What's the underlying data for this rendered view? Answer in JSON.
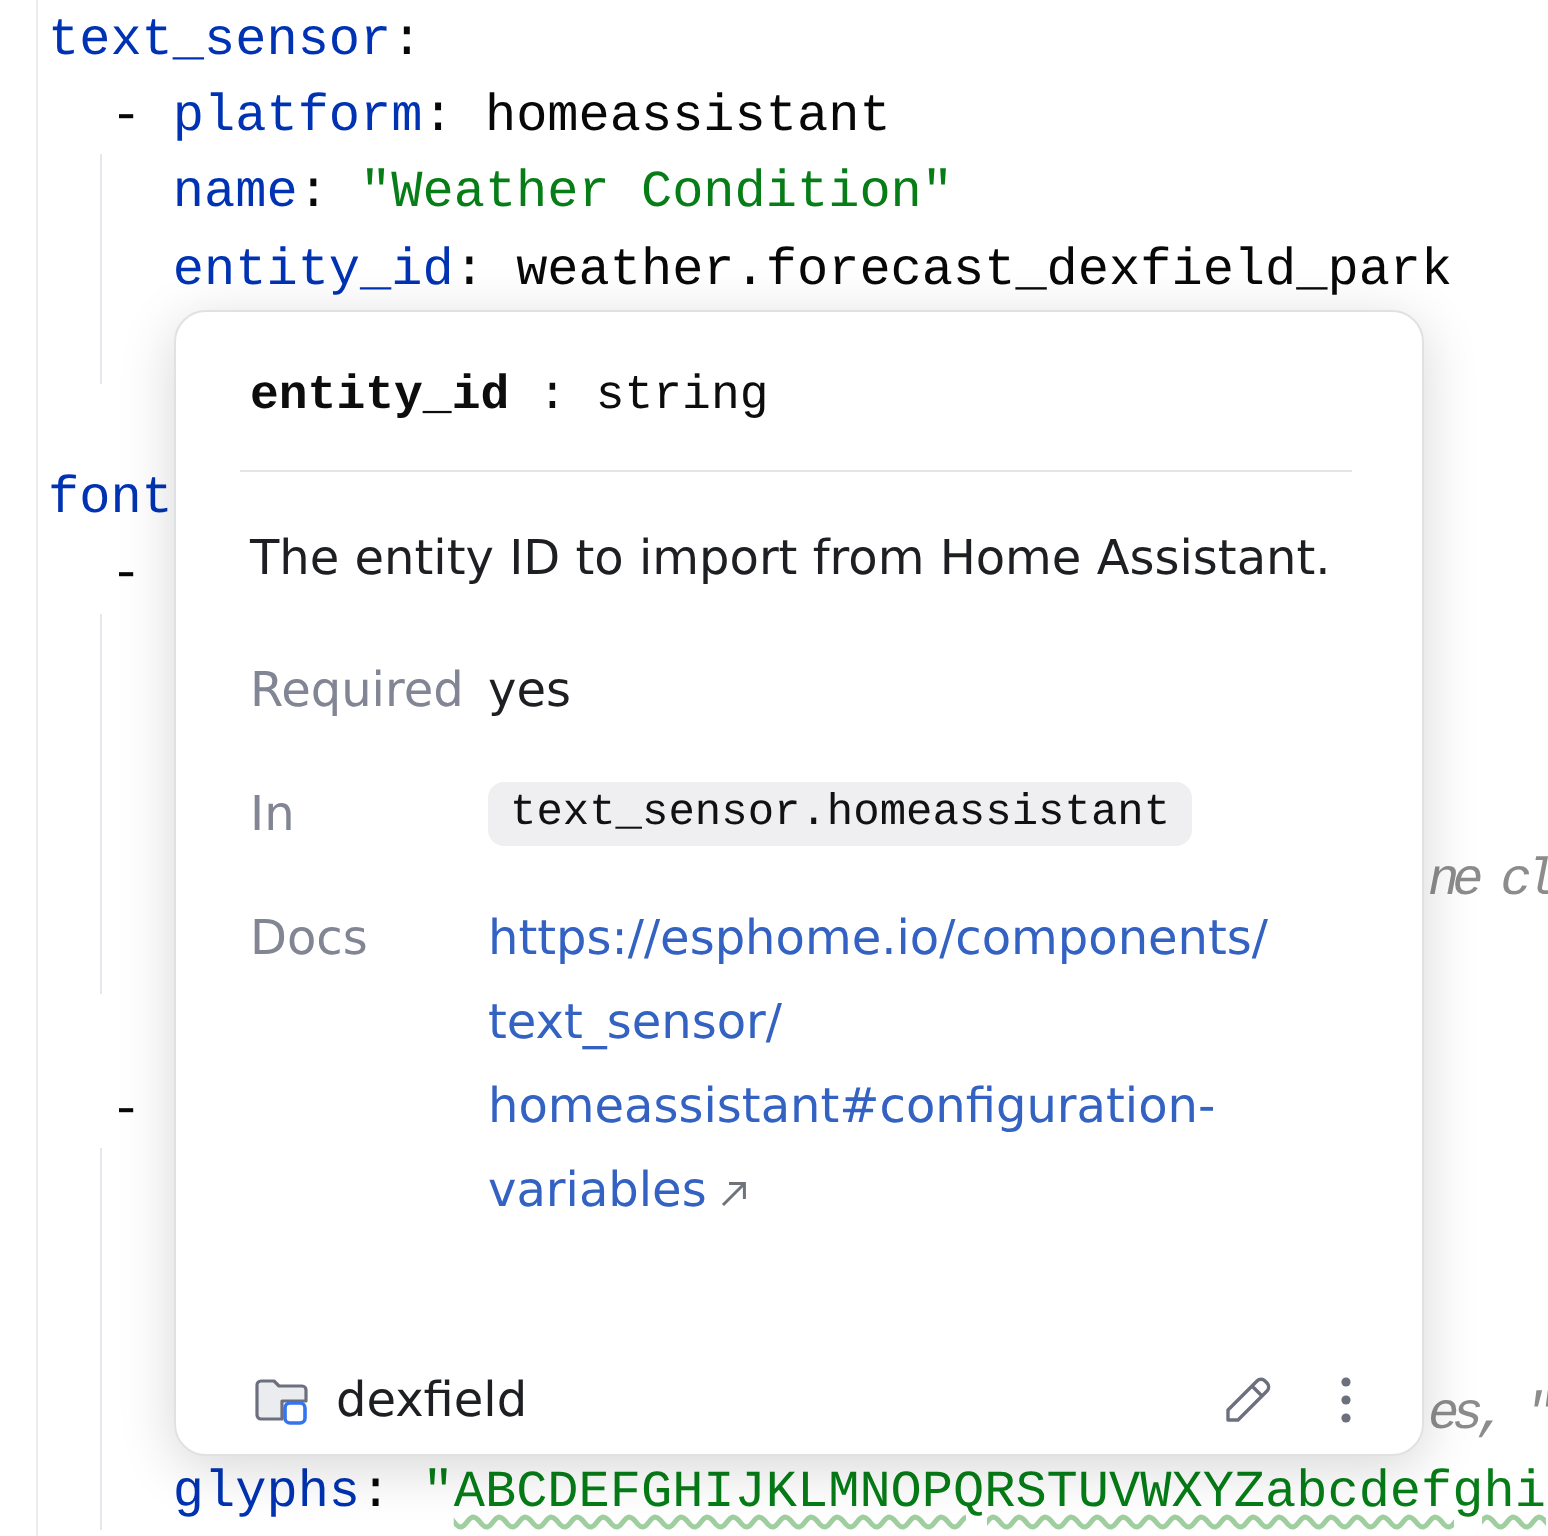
{
  "editor": {
    "code": [
      {
        "tokens": [
          {
            "kind": "key",
            "text": "text_sensor"
          },
          {
            "kind": "colon",
            "text": ":"
          }
        ],
        "children": [
          {
            "tokens": [
              {
                "kind": "dash",
                "text": "-"
              },
              {
                "kind": "key",
                "text": "platform"
              },
              {
                "kind": "colon",
                "text": ":"
              },
              {
                "kind": "plain",
                "text": "homeassistant"
              }
            ],
            "children": [
              {
                "tokens": [
                  {
                    "kind": "key",
                    "text": "name"
                  },
                  {
                    "kind": "colon",
                    "text": ":"
                  },
                  {
                    "kind": "string",
                    "text": "\"Weather Condition\""
                  }
                ]
              },
              {
                "tokens": [
                  {
                    "kind": "key",
                    "text": "entity_id"
                  },
                  {
                    "kind": "colon",
                    "text": ":"
                  },
                  {
                    "kind": "plain",
                    "text": "weather.forecast_dexfield_park"
                  }
                ]
              }
            ]
          }
        ]
      },
      {
        "tokens": [
          {
            "kind": "key",
            "text": "font"
          }
        ],
        "children": [
          {
            "tokens": [
              {
                "kind": "dash",
                "text": "-"
              }
            ]
          },
          {
            "tokens": [
              {
                "kind": "dash",
                "text": "-"
              }
            ],
            "children": [
              {
                "tokens": [
                  {
                    "kind": "key",
                    "text": "glyphs"
                  },
                  {
                    "kind": "colon",
                    "text": ":"
                  },
                  {
                    "kind": "string",
                    "text": "\""
                  },
                  {
                    "kind": "flagged_string",
                    "text": "ABCDEFGHIJKLMNOPQRSTUVWXYZabcdefghi"
                  }
                ]
              }
            ]
          }
        ]
      }
    ],
    "comment_fragments": [
      {
        "text": "ne cl"
      },
      {
        "text": "es, \""
      }
    ]
  },
  "popup": {
    "signature": "**entity_id** : string",
    "description": "The entity ID to import from Home Assistant.",
    "fields": [
      {
        "kind": "text",
        "label": "Required",
        "value": "yes"
      },
      {
        "kind": "code",
        "label": "In",
        "value": "text_sensor.homeassistant"
      },
      {
        "kind": "link",
        "label": "Docs",
        "value": "https://esphome.io/components/text_sensor/homeassistant#configuration-variables"
      }
    ],
    "footer": {
      "project": "dexfield"
    }
  }
}
